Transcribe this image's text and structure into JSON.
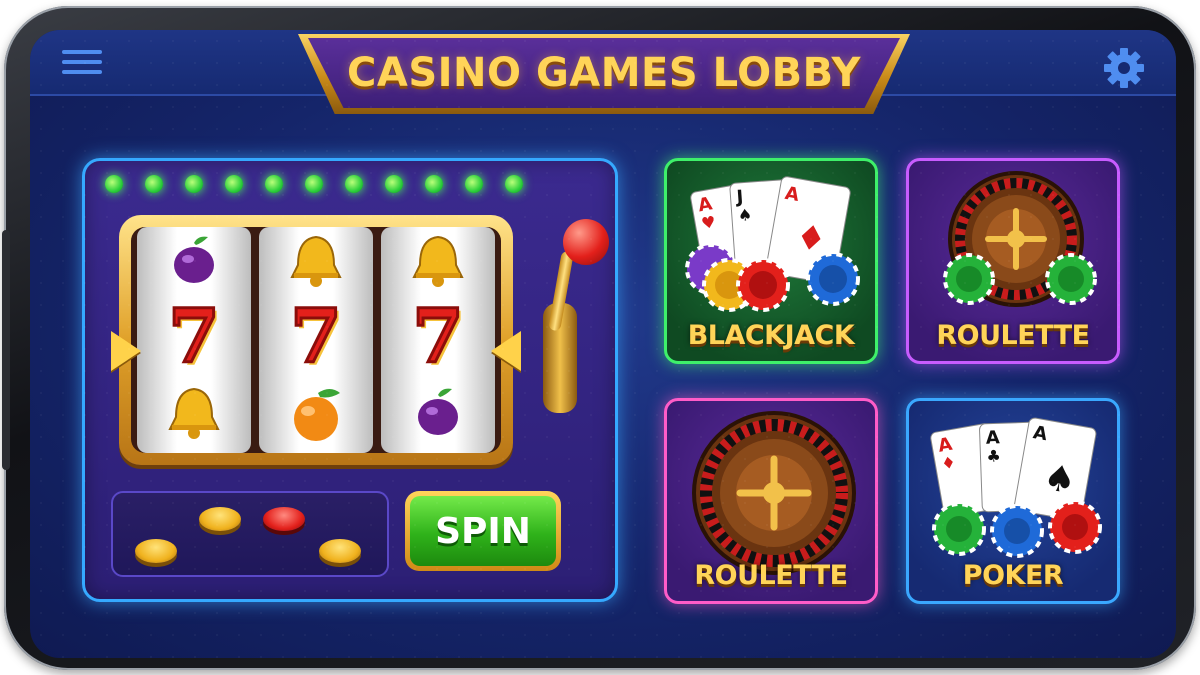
{
  "header": {
    "title": "CASINO GAMES LOBBY",
    "menu_icon": "hamburger-menu-icon",
    "settings_icon": "gear-icon"
  },
  "slot_machine": {
    "lights_count": 11,
    "reels": [
      {
        "top": "plum",
        "middle": "7",
        "bottom": "bell"
      },
      {
        "top": "bell",
        "middle": "7",
        "bottom": "orange"
      },
      {
        "top": "bell",
        "middle": "7",
        "bottom": "plum"
      }
    ],
    "spin_label": "SPIN"
  },
  "games": [
    {
      "label": "BLACKJACK",
      "icon": "blackjack-cards-chips-icon"
    },
    {
      "label": "ROULETTE",
      "icon": "roulette-wheel-icon"
    },
    {
      "label": "ROULETTE",
      "icon": "roulette-wheel-icon"
    },
    {
      "label": "POKER",
      "icon": "poker-cards-chips-icon"
    }
  ],
  "colors": {
    "background": "#15256a",
    "title_gold": "#ffd458",
    "blackjack_border": "#3ef06a",
    "roulette_border_top": "#c85cff",
    "roulette_border_bottom": "#ff5cc8",
    "poker_border": "#3aa8ff",
    "slot_border": "#35a9ff",
    "spin_green": "#2fb21a"
  }
}
